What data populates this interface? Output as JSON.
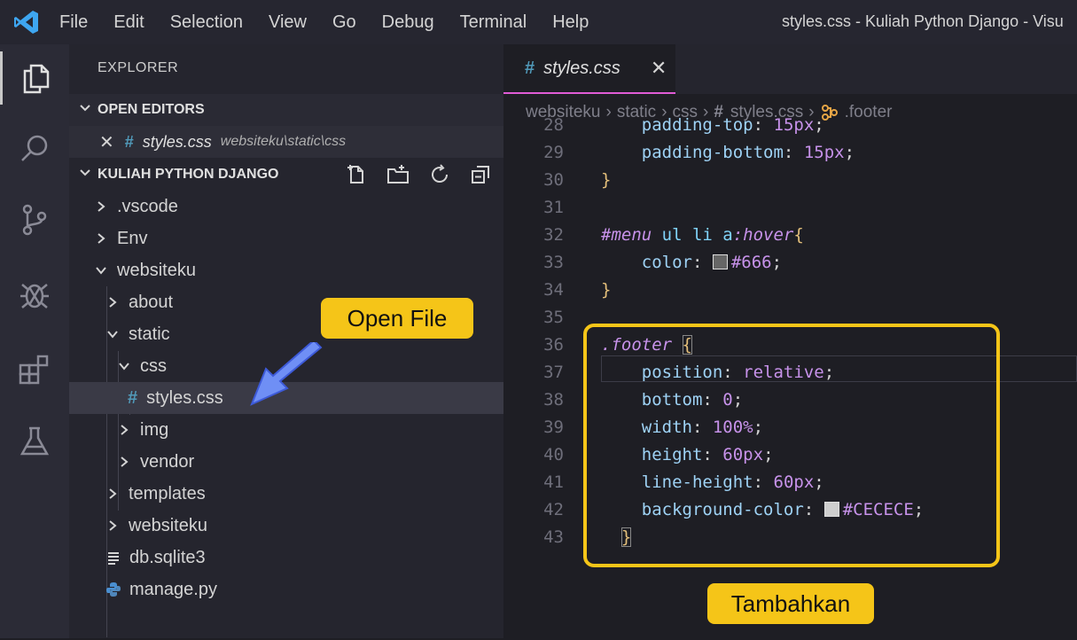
{
  "titlebar": {
    "menu": [
      "File",
      "Edit",
      "Selection",
      "View",
      "Go",
      "Debug",
      "Terminal",
      "Help"
    ],
    "window_title": "styles.css - Kuliah Python Django - Visu"
  },
  "sidebar": {
    "title": "EXPLORER",
    "open_editors_label": "OPEN EDITORS",
    "open_file": {
      "name": "styles.css",
      "path": "websiteku\\static\\css"
    },
    "project_label": "KULIAH PYTHON DJANGO",
    "tree": [
      {
        "label": ".vscode",
        "type": "folder-closed"
      },
      {
        "label": "Env",
        "type": "folder-closed"
      },
      {
        "label": "websiteku",
        "type": "folder-open"
      },
      {
        "label": "about",
        "type": "folder-closed"
      },
      {
        "label": "static",
        "type": "folder-open"
      },
      {
        "label": "css",
        "type": "folder-open"
      },
      {
        "label": "styles.css",
        "type": "css-file"
      },
      {
        "label": "img",
        "type": "folder-closed"
      },
      {
        "label": "vendor",
        "type": "folder-closed"
      },
      {
        "label": "templates",
        "type": "folder-closed"
      },
      {
        "label": "websiteku",
        "type": "folder-closed"
      },
      {
        "label": "db.sqlite3",
        "type": "db-file"
      },
      {
        "label": "manage.py",
        "type": "python-file"
      }
    ]
  },
  "editor": {
    "tab_label": "styles.css",
    "breadcrumbs": [
      "websiteku",
      "static",
      "css",
      "styles.css",
      ".footer"
    ],
    "line_numbers": [
      "28",
      "29",
      "30",
      "31",
      "32",
      "33",
      "34",
      "35",
      "36",
      "37",
      "38",
      "39",
      "40",
      "41",
      "42",
      "43"
    ],
    "code": {
      "l28_prop": "padding-top",
      "l28_val": "15px",
      "l29_prop": "padding-bottom",
      "l29_val": "15px",
      "l32_sel": "#menu",
      "l32_tags": "ul li a",
      "l32_pseudo": ":hover",
      "l33_prop": "color",
      "l33_val": "#666",
      "l36_sel": ".footer",
      "l37_prop": "position",
      "l37_val": "relative",
      "l38_prop": "bottom",
      "l38_val": "0",
      "l39_prop": "width",
      "l39_val": "100%",
      "l40_prop": "height",
      "l40_val": "60px",
      "l41_prop": "line-height",
      "l41_val": "60px",
      "l42_prop": "background-color",
      "l42_val": "#CECECE"
    }
  },
  "annotations": {
    "open_file": "Open File",
    "add": "Tambahkan"
  },
  "colors": {
    "highlight": "#f5c518",
    "tab_accent": "#e05bd6",
    "css_hash": "#519aba"
  }
}
